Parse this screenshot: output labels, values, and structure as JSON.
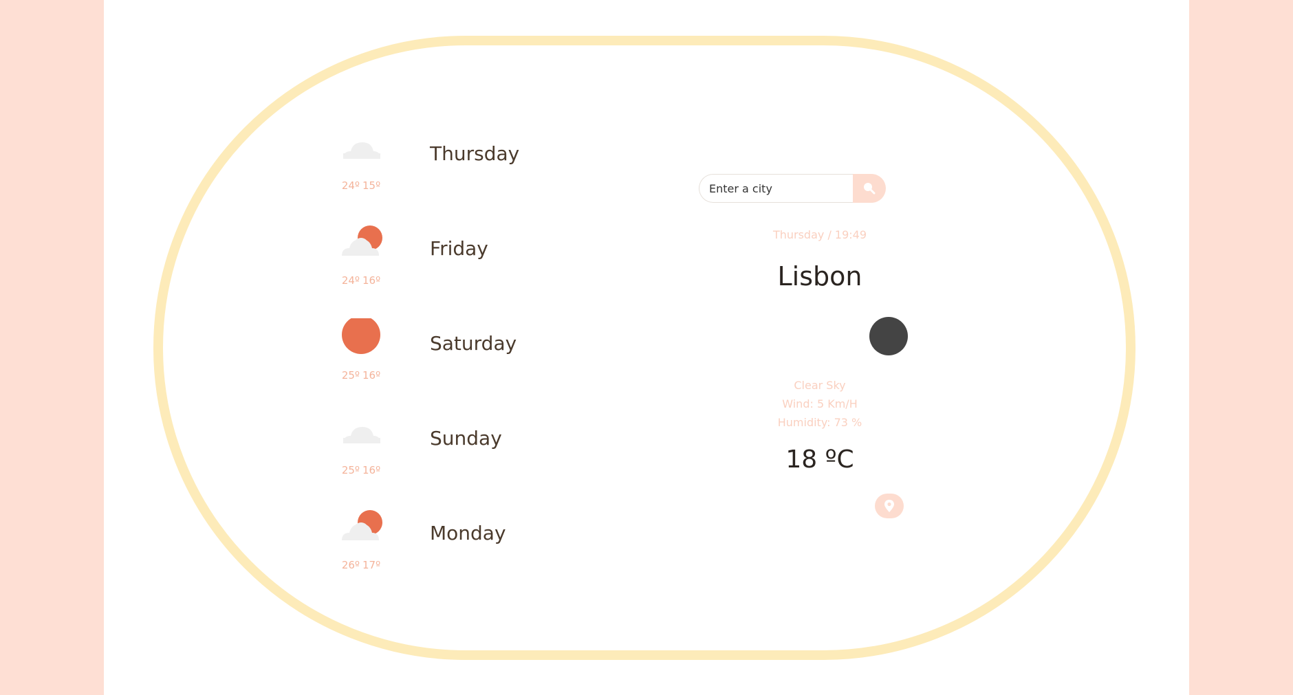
{
  "forecast": {
    "days": [
      {
        "name": "Thursday",
        "max": "24º",
        "min": "15º",
        "icon": "cloud-icon"
      },
      {
        "name": "Friday",
        "max": "24º",
        "min": "16º",
        "icon": "sun-behind-cloud-icon"
      },
      {
        "name": "Saturday",
        "max": "25º",
        "min": "16º",
        "icon": "sun-icon"
      },
      {
        "name": "Sunday",
        "max": "25º",
        "min": "16º",
        "icon": "cloud-icon"
      },
      {
        "name": "Monday",
        "max": "26º",
        "min": "17º",
        "icon": "sun-behind-cloud-icon"
      }
    ]
  },
  "search": {
    "placeholder": "Enter a city",
    "icon": "search-icon"
  },
  "current": {
    "datetime": "Thursday / 19:49",
    "city": "Lisbon",
    "icon": "moon-icon",
    "description": "Clear Sky",
    "wind": "Wind: 5 Km/H",
    "humidity": "Humidity: 73 %",
    "temperature": "18 ºC"
  },
  "location_button": {
    "icon": "location-pin-icon"
  },
  "colors": {
    "background": "#FEDFD4",
    "frame": "#FDEBB9",
    "accent_sun": "#E8704E",
    "cloud": "#EFEFEF",
    "muted_text": "#F4B39A",
    "night_icon": "#444444"
  }
}
